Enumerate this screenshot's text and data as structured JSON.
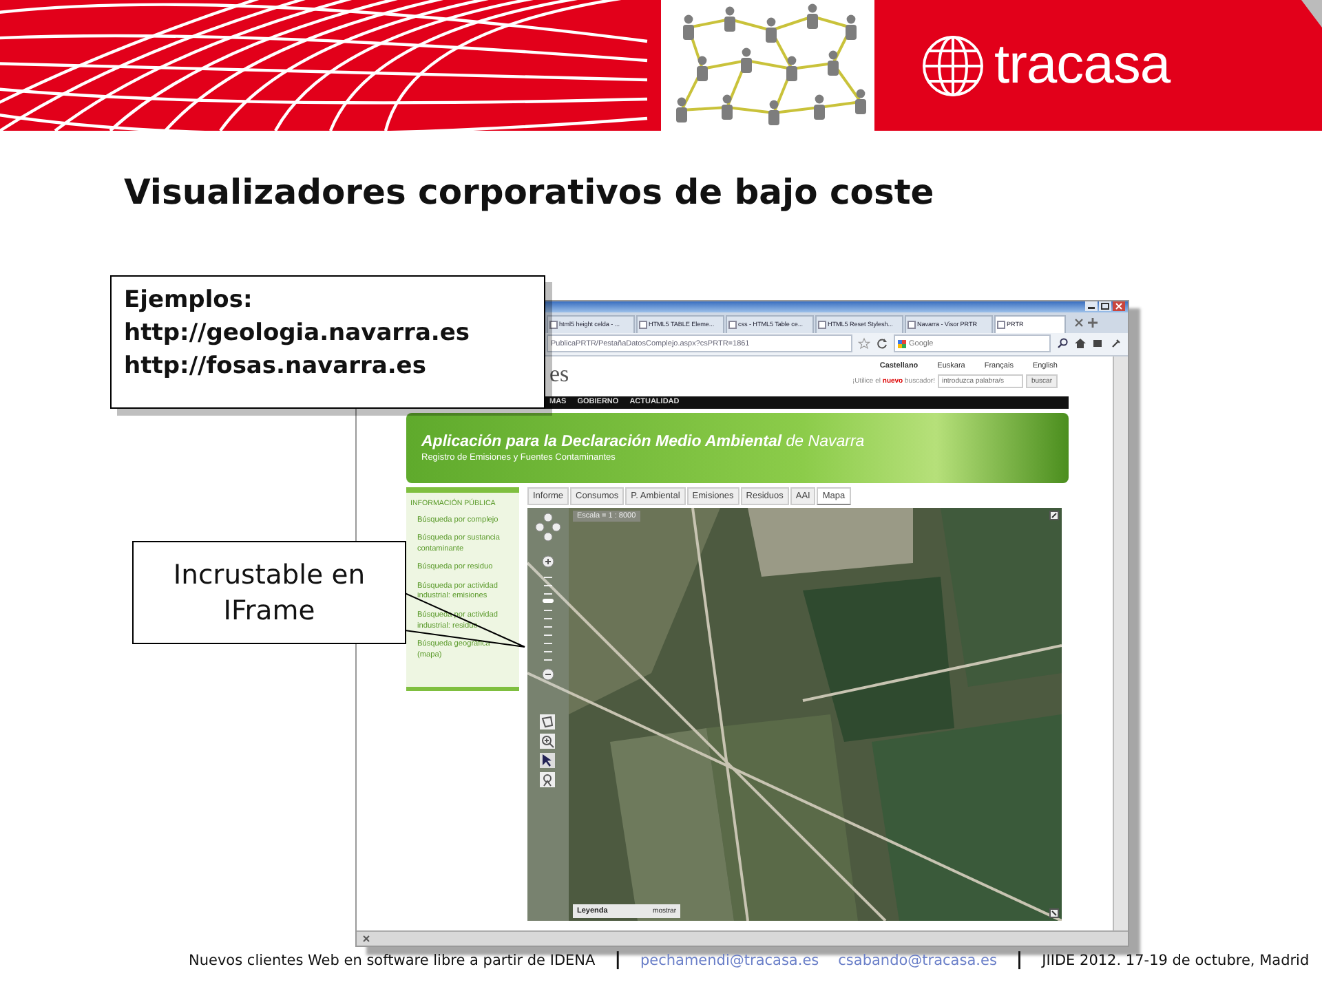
{
  "header": {
    "brand": "tracasa"
  },
  "slide_title": "Visualizadores corporativos de bajo coste",
  "browser": {
    "tabs": [
      {
        "label": "html5 height celda - ...",
        "selected": false
      },
      {
        "label": "HTML5 TABLE Eleme...",
        "selected": false
      },
      {
        "label": "css - HTML5 Table ce...",
        "selected": false
      },
      {
        "label": "HTML5 Reset Stylesh...",
        "selected": false
      },
      {
        "label": "Navarra - Visor PRTR",
        "selected": false
      },
      {
        "label": "PRTR",
        "selected": true
      }
    ],
    "address": "PublicaPRTR/PestañaDatosComplejo.aspx?csPRTR=1861",
    "search_placeholder": "Google",
    "site": {
      "logo_fragment": "es",
      "languages": [
        {
          "label": "Castellano",
          "selected": true
        },
        {
          "label": "Euskara",
          "selected": false
        },
        {
          "label": "Français",
          "selected": false
        },
        {
          "label": "English",
          "selected": false
        }
      ],
      "search_prompt": "¡Utilice el **nuevo** buscador!",
      "search_placeholder": "introduzca palabra/s",
      "search_button": "buscar",
      "nav": [
        "MAS",
        "GOBIERNO",
        "ACTUALIDAD"
      ],
      "banner": {
        "title": "**Aplicación para la Declaración Medio Ambiental** de Navarra",
        "subtitle": "Registro de Emisiones y Fuentes Contaminantes"
      },
      "sidebar": {
        "heading": "INFORMACIÓN PÚBLICA",
        "items": [
          "Búsqueda por complejo",
          "Búsqueda por sustancia contaminante",
          "Búsqueda por residuo",
          "Búsqueda por actividad industrial: emisiones",
          "Búsqueda por actividad industrial: residuo",
          "Búsqueda geográfica (mapa)"
        ]
      },
      "tabs": [
        {
          "label": "Informe",
          "selected": false
        },
        {
          "label": "Consumos",
          "selected": false
        },
        {
          "label": "P. Ambiental",
          "selected": false
        },
        {
          "label": "Emisiones",
          "selected": false
        },
        {
          "label": "Residuos",
          "selected": false
        },
        {
          "label": "AAI",
          "selected": false
        },
        {
          "label": "Mapa",
          "selected": true
        }
      ],
      "map": {
        "scale": "Escala = 1 : 8000",
        "zoom": {
          "level": 0.7
        },
        "legend": "Leyenda",
        "legend_toggle": "mostrar"
      }
    }
  },
  "examples_callout": {
    "heading": "Ejemplos:",
    "links": [
      "http://geologia.navarra.es",
      "http://fosas.navarra.es"
    ]
  },
  "iframe_callout": {
    "text": "Incrustable en IFrame"
  },
  "footer": {
    "presentation": "Nuevos clientes Web en software libre a partir de IDENA",
    "separators": [
      "|",
      "|"
    ],
    "emails": [
      "pechamendi@tracasa.es",
      "csabando@tracasa.es"
    ],
    "event": "JIIDE 2012. 17-19 de octubre, Madrid"
  }
}
